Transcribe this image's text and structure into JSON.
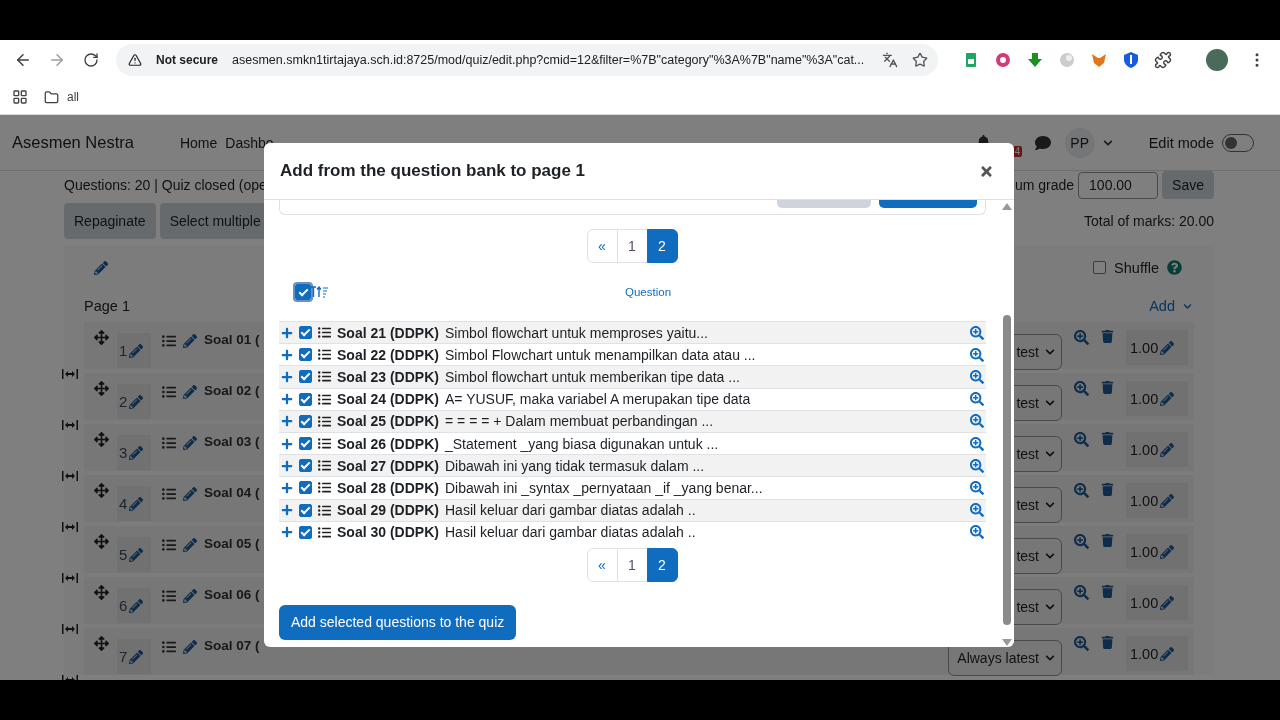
{
  "browser": {
    "security": "Not secure",
    "url": "asesmen.smkn1tirtajaya.sch.id:8725/mod/quiz/edit.php?cmid=12&filter=%7B\"category\"%3A%7B\"name\"%3A\"cat...",
    "bookmarks": [
      {
        "label": "all"
      }
    ]
  },
  "site": {
    "brand": "Asesmen Nestra",
    "nav": [
      "Home",
      "Dashbo"
    ],
    "notification_count": "4",
    "user_initials": "PP",
    "edit_mode": {
      "label": "Edit mode",
      "on": false
    }
  },
  "quiz": {
    "info": "Questions: 20 | Quiz closed (ope",
    "buttons": [
      "Repaginate",
      "Select multiple"
    ],
    "max_grade_label": "um grade",
    "max_grade": "100.00",
    "save": "Save",
    "total_marks": "Total of marks: 20.00",
    "shuffle": {
      "label": "Shuffle",
      "checked": false
    },
    "page_label": "Page 1",
    "add": "Add",
    "slots": [
      {
        "number": "1",
        "name": "Soal 01 (",
        "behaviour": "test",
        "mark": "1.00"
      },
      {
        "number": "2",
        "name": "Soal 02 (",
        "behaviour": "test",
        "mark": "1.00"
      },
      {
        "number": "3",
        "name": "Soal 03 (",
        "behaviour": "test",
        "mark": "1.00"
      },
      {
        "number": "4",
        "name": "Soal 04 (",
        "behaviour": "test",
        "mark": "1.00"
      },
      {
        "number": "5",
        "name": "Soal 05 (",
        "behaviour": "test",
        "mark": "1.00"
      },
      {
        "number": "6",
        "name": "Soal 06 (",
        "behaviour": "test",
        "mark": "1.00"
      },
      {
        "number": "7",
        "name": "Soal 07 (",
        "behaviour": "Always latest",
        "mark": "1.00"
      }
    ]
  },
  "modal": {
    "title": "Add from the question bank to page 1",
    "pagination_top": [
      {
        "label": "«",
        "selected": false
      },
      {
        "label": "1",
        "selected": false
      },
      {
        "label": "2",
        "selected": true
      }
    ],
    "select_all": {
      "checked": true
    },
    "column": "Question",
    "rows": [
      {
        "name": "Soal 21 (DDPK)",
        "text": "Simbol flowchart untuk memproses yaitu...",
        "checked": true
      },
      {
        "name": "Soal 22 (DDPK)",
        "text": "Simbol Flowchart untuk menampilkan data atau ...",
        "checked": true
      },
      {
        "name": "Soal 23 (DDPK)",
        "text": "Simbol flowchart untuk memberikan tipe data ...",
        "checked": true
      },
      {
        "name": "Soal 24 (DDPK)",
        "text": "A= YUSUF, maka variabel A merupakan tipe data",
        "checked": true
      },
      {
        "name": "Soal 25 (DDPK)",
        "text": "= = = = + Dalam membuat perbandingan ...",
        "checked": true
      },
      {
        "name": "Soal 26 (DDPK)",
        "text": "_Statement _yang biasa digunakan untuk ...",
        "checked": true
      },
      {
        "name": "Soal 27 (DDPK)",
        "text": "Dibawah ini yang tidak termasuk dalam ...",
        "checked": true
      },
      {
        "name": "Soal 28 (DDPK)",
        "text": "Dibawah ini _syntax _pernyataan _if _yang benar...",
        "checked": true
      },
      {
        "name": "Soal 29 (DDPK)",
        "text": "Hasil keluar dari gambar diatas adalah ..",
        "checked": true
      },
      {
        "name": "Soal 30 (DDPK)",
        "text": "Hasil keluar dari gambar diatas adalah ..",
        "checked": true
      }
    ],
    "pagination_bottom": [
      {
        "label": "«",
        "selected": false
      },
      {
        "label": "1",
        "selected": false
      },
      {
        "label": "2",
        "selected": true
      }
    ],
    "submit": "Add selected questions to the quiz"
  }
}
